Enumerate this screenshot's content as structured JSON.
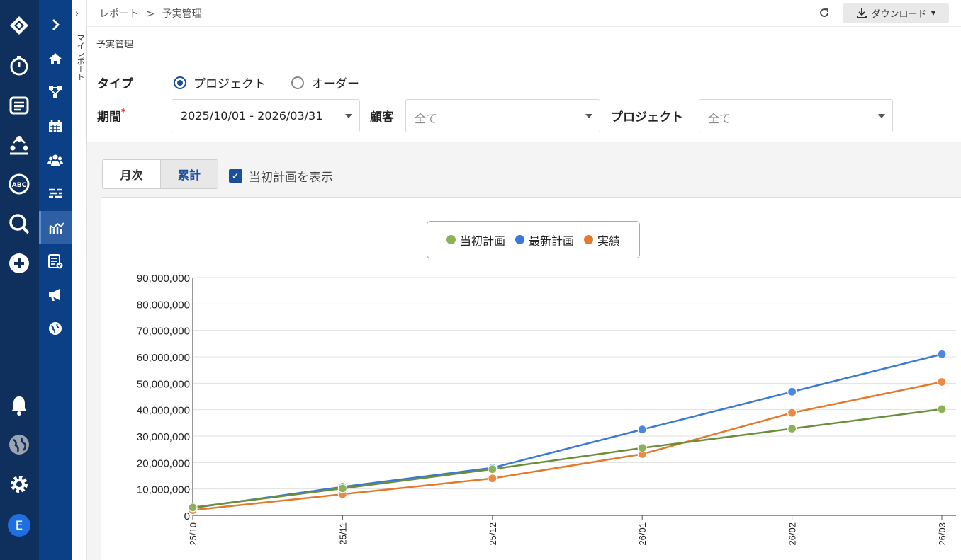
{
  "breadcrumb": {
    "parent": "レポート",
    "sep": ">",
    "current": "予実管理"
  },
  "header": {
    "download_label": "ダウンロード"
  },
  "sidebar": {
    "vertical_label": "マイレポート"
  },
  "filters": {
    "page_title": "予実管理",
    "type_label": "タイプ",
    "type_options": [
      "プロジェクト",
      "オーダー"
    ],
    "type_selected": "プロジェクト",
    "period_label": "期間",
    "period_required": "*",
    "period_value": "2025/10/01 - 2026/03/31",
    "customer_label": "顧客",
    "customer_value": "全て",
    "project_label": "プロジェクト",
    "project_value": "全て"
  },
  "view": {
    "tabs": [
      "月次",
      "累計"
    ],
    "selected_tab": "累計",
    "show_initial_plan_label": "当初計画を表示",
    "show_initial_plan": true
  },
  "colors": {
    "initial_plan": "#6a8f3a",
    "latest_plan": "#3b78d8",
    "actual": "#e4782b",
    "accent": "#1a4f9c"
  },
  "chart_data": {
    "type": "line",
    "categories": [
      "25/10",
      "25/11",
      "25/12",
      "26/01",
      "26/02",
      "26/03"
    ],
    "series": [
      {
        "name": "当初計画",
        "values": [
          3000000,
          10200000,
          17500000,
          25500000,
          32800000,
          40200000
        ]
      },
      {
        "name": "最新計画",
        "values": [
          2800000,
          10800000,
          18000000,
          32500000,
          46800000,
          61000000
        ]
      },
      {
        "name": "実績",
        "values": [
          2000000,
          8000000,
          14000000,
          23200000,
          38800000,
          50500000
        ]
      }
    ],
    "ylim": [
      0,
      90000000
    ],
    "yticks": [
      "90,000,000",
      "80,000,000",
      "70,000,000",
      "60,000,000",
      "50,000,000",
      "40,000,000",
      "30,000,000",
      "20,000,000",
      "10,000,000",
      "0"
    ],
    "legend": "top-center",
    "grid": true
  }
}
